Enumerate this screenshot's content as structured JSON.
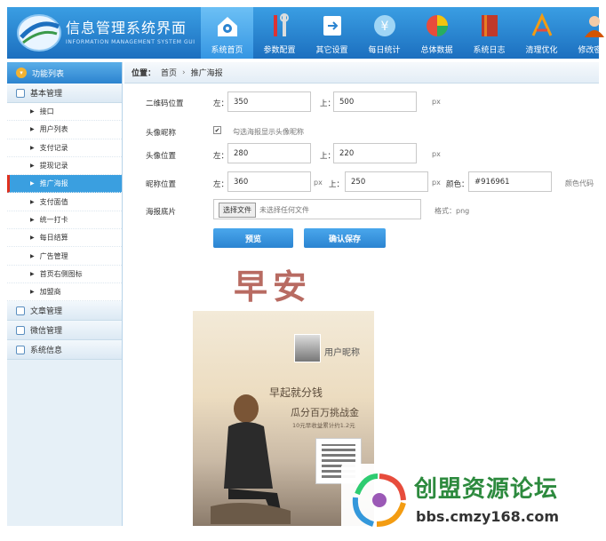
{
  "header": {
    "brand_title": "信息管理系统界面",
    "brand_subtitle": "INFORMATION MANAGEMENT SYSTEM GUI",
    "nav": [
      {
        "label": "系统首页",
        "icon": "home-icon",
        "active": true
      },
      {
        "label": "参数配置",
        "icon": "tools-icon",
        "active": false
      },
      {
        "label": "其它设置",
        "icon": "exit-icon",
        "active": false
      },
      {
        "label": "每日统计",
        "icon": "yen-icon",
        "active": false
      },
      {
        "label": "总体数据",
        "icon": "pie-chart-icon",
        "active": false
      },
      {
        "label": "系统日志",
        "icon": "book-icon",
        "active": false
      },
      {
        "label": "清理优化",
        "icon": "broom-icon",
        "active": false
      },
      {
        "label": "修改密码",
        "icon": "user-icon",
        "active": false
      }
    ]
  },
  "sidebar": {
    "header": "功能列表",
    "groups": [
      {
        "label": "基本管理"
      },
      {
        "label": "文章管理"
      },
      {
        "label": "微信管理"
      },
      {
        "label": "系统信息"
      }
    ],
    "items": [
      {
        "label": "接口"
      },
      {
        "label": "用户列表"
      },
      {
        "label": "支付记录"
      },
      {
        "label": "提现记录"
      },
      {
        "label": "推广海报"
      },
      {
        "label": "支付面值"
      },
      {
        "label": "统一打卡"
      },
      {
        "label": "每日结算"
      },
      {
        "label": "广告管理"
      },
      {
        "label": "首页右侧图标"
      },
      {
        "label": "加盟商"
      }
    ]
  },
  "breadcrumb": {
    "prefix": "位置：",
    "home": "首页",
    "sep": "›",
    "current": "推广海报"
  },
  "form": {
    "qr_label": "二维码位置",
    "left_label": "左：",
    "top_label": "上：",
    "px": "px",
    "qr_left": "350",
    "qr_top": "500",
    "avatar_nick_label": "头像昵称",
    "avatar_nick_checked": "✔",
    "avatar_nick_hint": "勾选海报显示头像昵称",
    "avatar_pos_label": "头像位置",
    "avatar_left": "280",
    "avatar_top": "220",
    "nick_pos_label": "昵称位置",
    "nick_left": "360",
    "nick_top": "250",
    "color_label": "颜色：",
    "color_value": "#916961",
    "color_hint": "颜色代码",
    "bg_label": "海报底片",
    "file_btn": "选择文件",
    "file_text": "未选择任何文件",
    "format_hint": "格式：png",
    "preview_btn": "预览",
    "save_btn": "确认保存"
  },
  "poster": {
    "greeting": "早安",
    "nickname": "用户昵称",
    "line1": "早起就分钱",
    "line2": "瓜分百万挑战金",
    "line3": "10元早收益累计约1.2元"
  },
  "watermark": {
    "cn": "创盟资源论坛",
    "url": "bbs.cmzy168.com"
  },
  "colors": {
    "header_blue": "#1c6fbf",
    "active_item": "#3a9fe0",
    "button": "#2b84d1",
    "greeting": "#b86b62"
  }
}
